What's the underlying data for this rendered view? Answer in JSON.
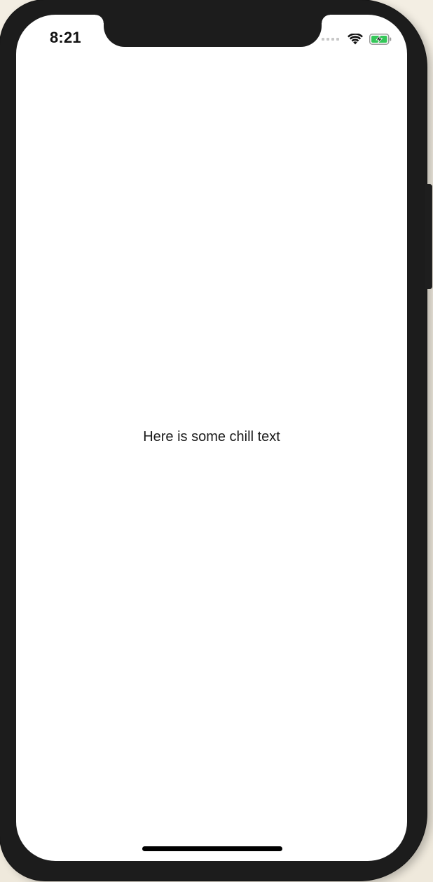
{
  "status_bar": {
    "time": "8:21",
    "signal_icon": "cellular-signal-icon",
    "wifi_icon": "wifi-icon",
    "battery_icon": "battery-charging-icon",
    "battery_color": "#34c759"
  },
  "content": {
    "text": "Here is some chill text"
  },
  "colors": {
    "device_frame": "#1c1c1c",
    "background": "#f1ece0",
    "screen": "#ffffff"
  }
}
